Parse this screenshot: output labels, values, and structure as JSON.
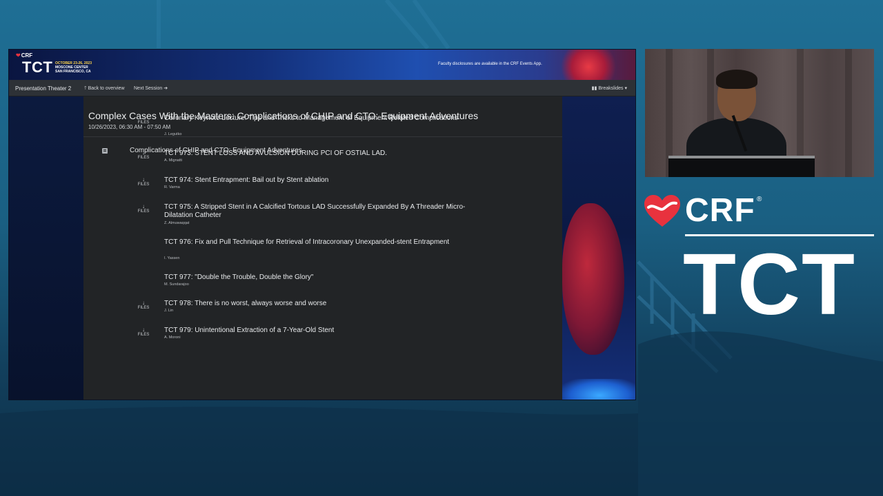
{
  "banner": {
    "crf": "CRF",
    "tct": "TCT",
    "dates": "OCTOBER 23-26, 2023",
    "venue": "MOSCONE CENTER",
    "city": "SAN FRANCISCO, CA",
    "disclosure": "Faculty disclosures are available in the CRF Events App."
  },
  "nav": {
    "theater": "Presentation Theater 2",
    "back": "Back to overview",
    "next": "Next Session",
    "breakslides": "Breakslides"
  },
  "session": {
    "title": "Complex Cases With the Masters: Complications of CHIP and CTO: Equipment Adventures",
    "time": "10/26/2023, 06:30 AM - 07:50 AM",
    "name": "Complications of CHIP and CTO: Equipment Adventures"
  },
  "files_label": "FILES",
  "talks": [
    {
      "title": "Coronary Keynote Lecture: Tips and Tricks to Management of Equipment Related Complications",
      "author": "J. Legutko",
      "has_files": true
    },
    {
      "title": "TCT 973: STENT LOSS AND AVULSION DURING PCI OF OSTIAL LAD.",
      "author": "A. Mignatti",
      "has_files": true
    },
    {
      "title": "TCT 974: Stent Entrapment: Bail out by Stent ablation",
      "author": "R. Varma",
      "has_files": true
    },
    {
      "title": "TCT 975: A Stripped Stent in A Calcified Tortous LAD Successfully Expanded By A Threader Micro-Dilatation Catheter",
      "author": "Z. Almuwaqqat",
      "has_files": true
    },
    {
      "title": "TCT 976: Fix and Pull Technique for Retrieval of Intracoronary Unexpanded-stent Entrapment",
      "author": "I. Yassen",
      "has_files": false
    },
    {
      "title": "TCT 977: \"Double the Trouble, Double the Glory\"",
      "author": "M. Sundarajoo",
      "has_files": false
    },
    {
      "title": "TCT 978: There is no worst, always worse and worse",
      "author": "J. Lin",
      "has_files": true
    },
    {
      "title": "TCT 979: Unintentional Extraction of a 7-Year-Old Stent",
      "author": "A. Moroni",
      "has_files": true
    }
  ],
  "branding": {
    "crf": "CRF",
    "reg": "®",
    "tct": "TCT"
  },
  "colors": {
    "brand_red": "#e8323e",
    "background": "#1a5f82",
    "content_bg": "#222426",
    "navbar_bg": "#2d3136"
  }
}
